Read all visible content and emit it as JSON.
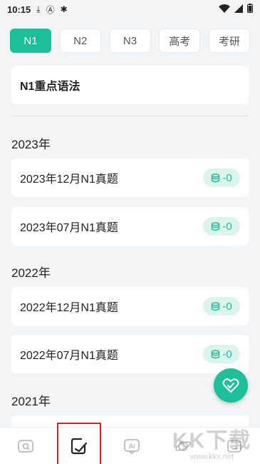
{
  "status_bar": {
    "time": "10:15"
  },
  "tabs": [
    {
      "label": "N1",
      "active": true
    },
    {
      "label": "N2",
      "active": false
    },
    {
      "label": "N3",
      "active": false
    },
    {
      "label": "高考",
      "active": false
    },
    {
      "label": "考研",
      "active": false
    }
  ],
  "grammar_card": {
    "label": "N1重点语法"
  },
  "sections": [
    {
      "year": "2023年",
      "items": [
        {
          "label": "2023年12月N1真题",
          "badge": "-0"
        },
        {
          "label": "2023年07月N1真题",
          "badge": "-0"
        }
      ]
    },
    {
      "year": "2022年",
      "items": [
        {
          "label": "2022年12月N1真题",
          "badge": "-0"
        },
        {
          "label": "2022年07月N1真题",
          "badge": "-0"
        }
      ]
    },
    {
      "year": "2021年",
      "items": []
    }
  ],
  "bottom_nav": [
    {
      "icon": "study-card-icon"
    },
    {
      "icon": "exam-check-icon",
      "highlighted": true
    },
    {
      "icon": "ai-icon"
    },
    {
      "icon": "planet-icon"
    },
    {
      "icon": "profile-icon"
    }
  ],
  "watermark": {
    "title": "KK下载",
    "url": "www.kkx.net"
  },
  "colors": {
    "accent": "#1dbf9a",
    "badge_bg": "#dcf5ec",
    "highlight": "#e02020"
  }
}
